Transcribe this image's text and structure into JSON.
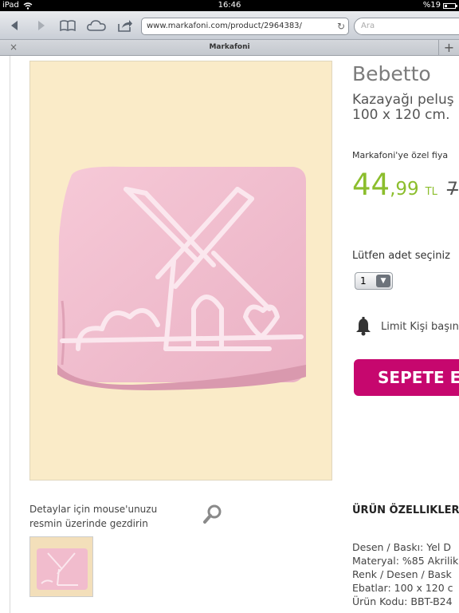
{
  "status_bar": {
    "device": "iPad",
    "time": "16:46",
    "battery": "%19"
  },
  "browser": {
    "url": "www.markafoni.com/product/2964383/",
    "search_placeholder": "Ara",
    "tab_title": "Markafoni",
    "tab_close": "×",
    "new_tab": "+"
  },
  "icons": {
    "back": "back-arrow-icon",
    "forward": "forward-arrow-icon",
    "bookmarks": "bookmarks-book-icon",
    "cloud": "icloud-tabs-icon",
    "share": "share-icon",
    "reload": "reload-icon",
    "zoom": "magnifier-icon",
    "bell": "bell-icon",
    "wifi": "wifi-icon"
  },
  "colors": {
    "price_green": "#8cbe2d",
    "cart_magenta": "#c6076e",
    "image_bg": "#faebc8",
    "blanket_pink": "#f1bccd"
  },
  "product": {
    "brand": "Bebetto",
    "title_line1": "Kazayağı peluş",
    "title_line2": "100 x 120 cm.",
    "special_price_label": "Markafoni'ye özel fiya",
    "price_int": "44",
    "price_dec": ",99",
    "currency": "TL",
    "old_price": "7",
    "quantity_label": "Lütfen adet seçiniz",
    "quantity_value": "1",
    "limit_text": "Limit Kişi başın",
    "cart_button": "SEPETE E"
  },
  "gallery": {
    "hint_line1": "Detaylar için mouse'unuzu",
    "hint_line2": "resmin üzerinde gezdirin"
  },
  "features": {
    "title": "ÜRÜN ÖZELLIKLERI",
    "items": [
      "Desen / Baskı: Yel D",
      "Materyal: %85 Akrilik",
      "Renk / Desen / Bask",
      "Ebatlar: 100 x 120 c",
      "Ürün Kodu: BBT-B24"
    ]
  }
}
